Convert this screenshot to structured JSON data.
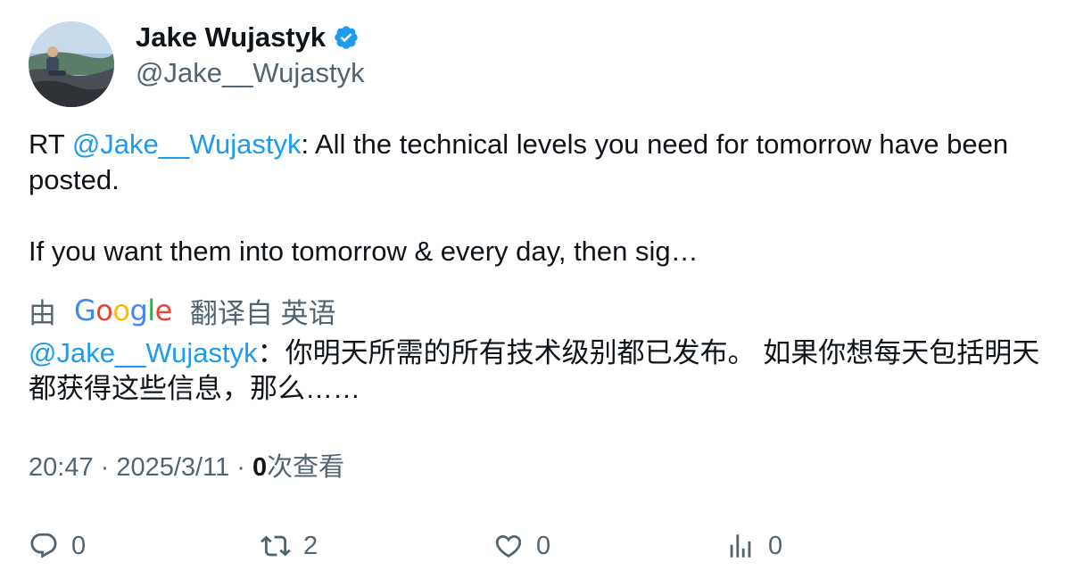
{
  "author": {
    "display_name": "Jake Wujastyk",
    "handle": "@Jake__Wujastyk",
    "verified_icon": "verified-badge-icon",
    "verified_color": "#1d9bf0"
  },
  "tweet": {
    "prefix": "RT ",
    "mention": "@Jake__Wujastyk",
    "text_after_mention": ": All the technical levels you need for tomorrow have been posted.\n\nIf you want them into tomorrow & every day, then sig…"
  },
  "translation": {
    "by_label": "由",
    "google_label": "Google",
    "from_label": "翻译自 英语",
    "mention": "@Jake__Wujastyk",
    "translated_text": "：你明天所需的所有技术级别都已发布。 如果你想每天包括明天都获得这些信息，那么……"
  },
  "meta": {
    "time": "20:47",
    "separator": " · ",
    "date": "2025/3/11",
    "views_count": "0",
    "views_label": "次查看"
  },
  "actions": {
    "reply_count": "0",
    "retweet_count": "2",
    "like_count": "0",
    "views_count": "0"
  },
  "colors": {
    "accent": "#1d9bf0",
    "muted": "#536471",
    "text": "#0f1419"
  }
}
